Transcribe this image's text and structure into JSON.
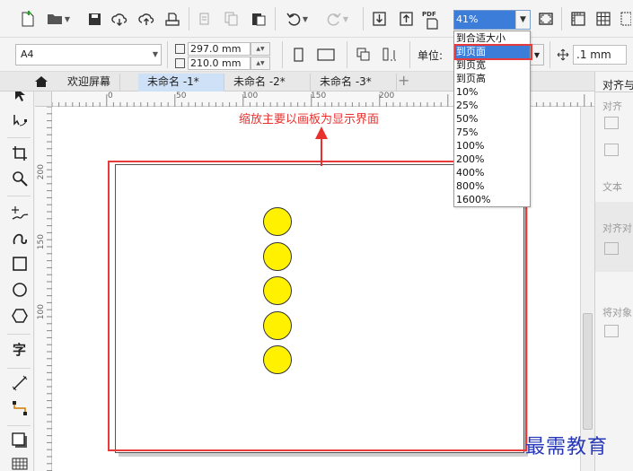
{
  "toolbar": {
    "pdf_label": "PDF",
    "zoom_value": "41%"
  },
  "property_bar": {
    "page_size": "A4",
    "width": "297.0 mm",
    "height": "210.0 mm",
    "unit_label": "单位:",
    "nudge_value": ".1 mm"
  },
  "tabs": {
    "welcome": "欢迎屏幕",
    "doc1": "未命名 -1*",
    "doc2": "未命名 -2*",
    "doc3": "未命名 -3*",
    "add": "+"
  },
  "ruler_top": [
    "0",
    "50",
    "100",
    "150",
    "200"
  ],
  "ruler_left": [
    "200",
    "150",
    "100"
  ],
  "annotation": "缩放主要以画板为显示界面",
  "zoom_options": [
    {
      "label": "到合适大小",
      "selected": false
    },
    {
      "label": "到页面",
      "selected": true
    },
    {
      "label": "到页宽",
      "selected": false
    },
    {
      "label": "到页高",
      "selected": false
    },
    {
      "label": "10%",
      "selected": false
    },
    {
      "label": "25%",
      "selected": false
    },
    {
      "label": "50%",
      "selected": false
    },
    {
      "label": "75%",
      "selected": false
    },
    {
      "label": "100%",
      "selected": false
    },
    {
      "label": "200%",
      "selected": false
    },
    {
      "label": "400%",
      "selected": false
    },
    {
      "label": "800%",
      "selected": false
    },
    {
      "label": "1600%",
      "selected": false
    }
  ],
  "docker": {
    "title": "对齐与",
    "section_align": "对齐",
    "section_text": "文本",
    "section_align_dist": "对齐对",
    "section_distribute": "将对象"
  },
  "watermark": "最需教育",
  "colors": {
    "accent": "#3b7dd8",
    "annotation_red": "#e8312f",
    "circle_fill": "#fff100"
  },
  "shapes": {
    "circle_count": 5
  }
}
